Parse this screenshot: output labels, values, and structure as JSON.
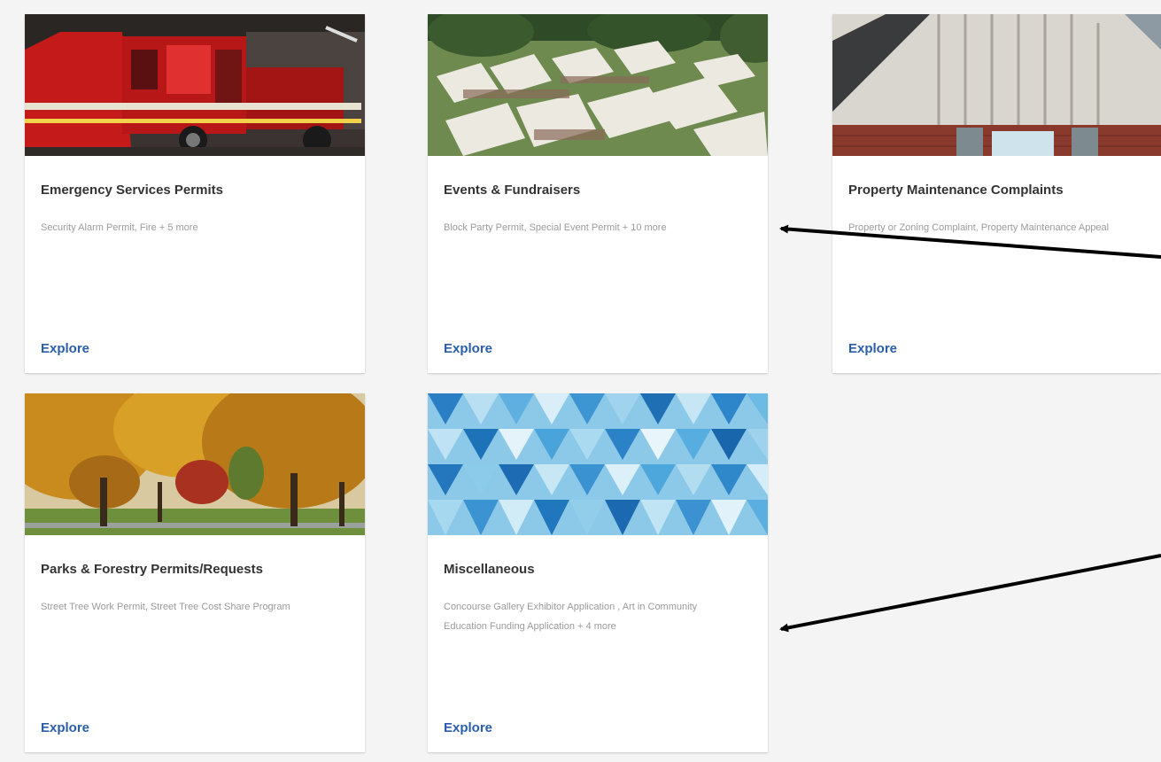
{
  "cards": [
    {
      "title": "Emergency Services Permits",
      "description": "Security Alarm Permit, Fire + 5 more",
      "link": "Explore",
      "image": "fire-truck-photo"
    },
    {
      "title": "Events & Fundraisers",
      "description": "Block Party Permit, Special Event Permit + 10 more",
      "link": "Explore",
      "image": "festival-tents-photo"
    },
    {
      "title": "Property Maintenance Complaints",
      "description": "Property or Zoning Complaint, Property Maintenance Appeal",
      "link": "Explore",
      "image": "house-siding-photo"
    },
    {
      "title": "Parks & Forestry Permits/Requests",
      "description": "Street Tree Work Permit, Street Tree Cost Share Program",
      "link": "Explore",
      "image": "autumn-trees-photo"
    },
    {
      "title": "Miscellaneous",
      "description": "Concourse Gallery Exhibitor Application , Art in Community Education Funding Application + 4 more",
      "link": "Explore",
      "image": "blue-triangles-pattern"
    }
  ],
  "colors": {
    "background": "#f4f4f4",
    "card": "#ffffff",
    "title": "#333333",
    "description": "#9b9b9b",
    "link": "#2a5ea8",
    "arrow": "#000000"
  }
}
